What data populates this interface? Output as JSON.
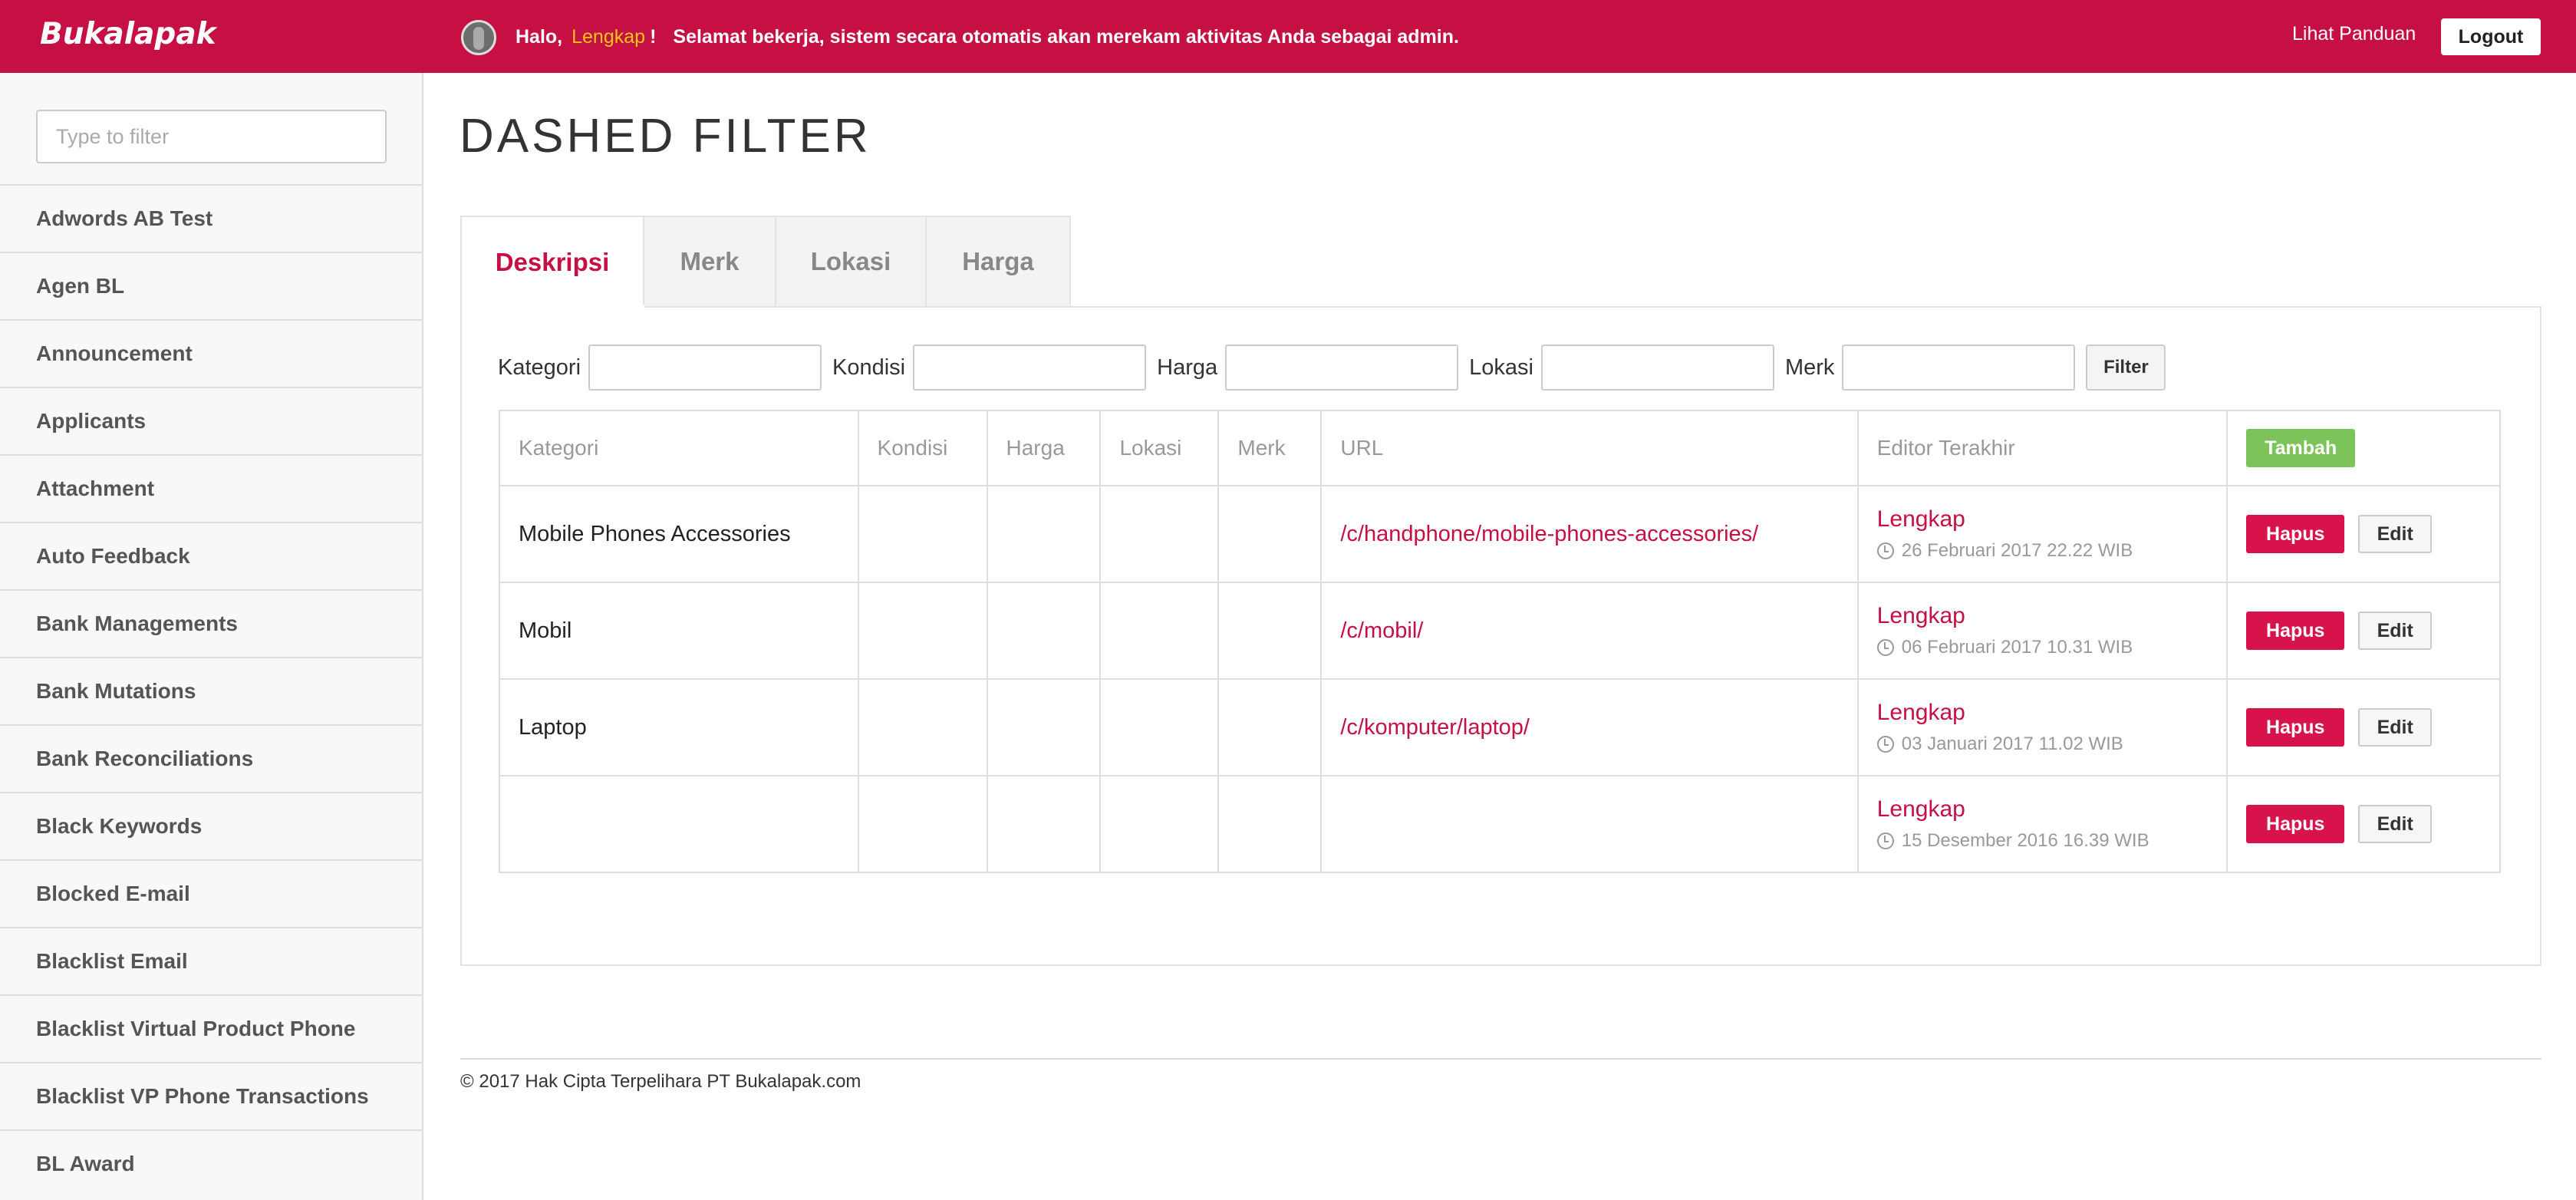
{
  "header": {
    "logo": "Bukalapak",
    "greeting_prefix": "Halo,",
    "user_name": "Lengkap",
    "greeting_suffix": "!",
    "message": "Selamat bekerja, sistem secara otomatis akan merekam aktivitas Anda sebagai admin.",
    "guide_link": "Lihat Panduan",
    "logout_label": "Logout",
    "accent_color": "#c60f42"
  },
  "sidebar": {
    "filter_placeholder": "Type to filter",
    "items": [
      "Adwords AB Test",
      "Agen BL",
      "Announcement",
      "Applicants",
      "Attachment",
      "Auto Feedback",
      "Bank Managements",
      "Bank Mutations",
      "Bank Reconciliations",
      "Black Keywords",
      "Blocked E-mail",
      "Blacklist Email",
      "Blacklist Virtual Product Phone",
      "Blacklist VP Phone Transactions",
      "BL Award"
    ]
  },
  "main": {
    "title": "DASHED FILTER",
    "tabs": [
      "Deskripsi",
      "Merk",
      "Lokasi",
      "Harga"
    ],
    "active_tab": "Deskripsi",
    "filters": [
      "Kategori",
      "Kondisi",
      "Harga",
      "Lokasi",
      "Merk"
    ],
    "filter_button": "Filter",
    "table": {
      "columns": [
        "Kategori",
        "Kondisi",
        "Harga",
        "Lokasi",
        "Merk",
        "URL",
        "Editor Terakhir"
      ],
      "add_button": "Tambah",
      "delete_button": "Hapus",
      "edit_button": "Edit",
      "rows": [
        {
          "kategori": "Mobile Phones Accessories",
          "kondisi": "",
          "harga": "",
          "lokasi": "",
          "merk": "",
          "url": "/c/handphone/mobile-phones-accessories/",
          "editor": "Lengkap",
          "time": "26 Februari 2017 22.22 WIB"
        },
        {
          "kategori": "Mobil",
          "kondisi": "",
          "harga": "",
          "lokasi": "",
          "merk": "",
          "url": "/c/mobil/",
          "editor": "Lengkap",
          "time": "06 Februari 2017 10.31 WIB"
        },
        {
          "kategori": "Laptop",
          "kondisi": "",
          "harga": "",
          "lokasi": "",
          "merk": "",
          "url": "/c/komputer/laptop/",
          "editor": "Lengkap",
          "time": "03 Januari 2017 11.02 WIB"
        },
        {
          "kategori": "",
          "kondisi": "",
          "harga": "",
          "lokasi": "",
          "merk": "",
          "url": "",
          "editor": "Lengkap",
          "time": "15 Desember 2016 16.39 WIB"
        }
      ]
    }
  },
  "footer": {
    "copyright": "© 2017 Hak Cipta Terpelihara PT Bukalapak.com"
  }
}
